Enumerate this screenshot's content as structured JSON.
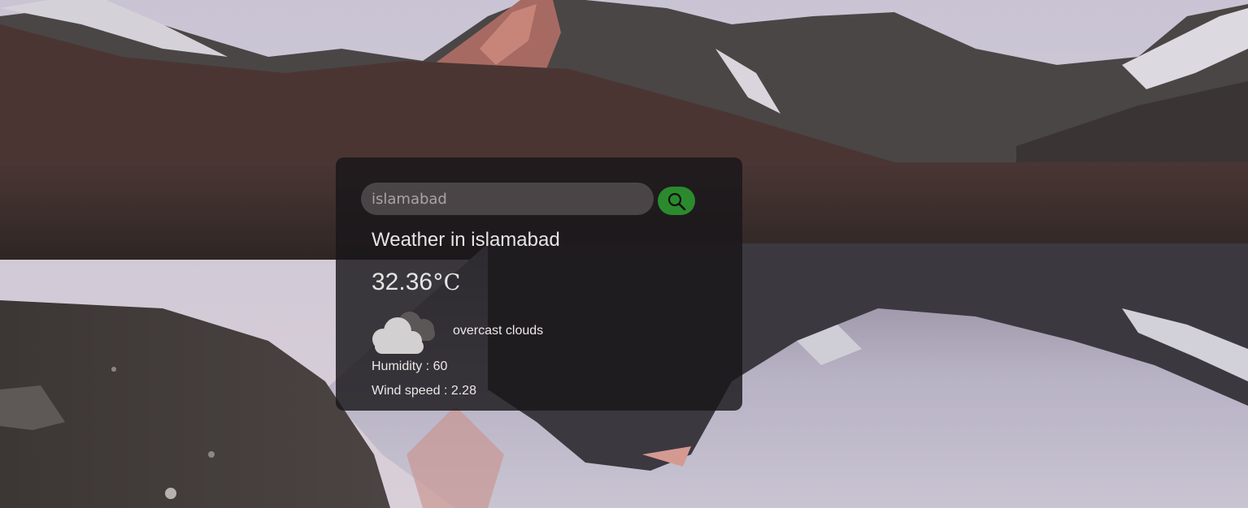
{
  "search": {
    "value": "islamabad",
    "placeholder": "Search"
  },
  "weather": {
    "title": "Weather in islamabad",
    "temperature": "32.36",
    "unit": "°C",
    "description": "overcast clouds",
    "icon": "cloud-icon",
    "humidity_text": "Humidity : 60",
    "wind_text": "Wind speed : 2.28"
  },
  "colors": {
    "card_background": "#18161a",
    "search_button": "#2b8a2e",
    "text": "#e6e4e4"
  }
}
